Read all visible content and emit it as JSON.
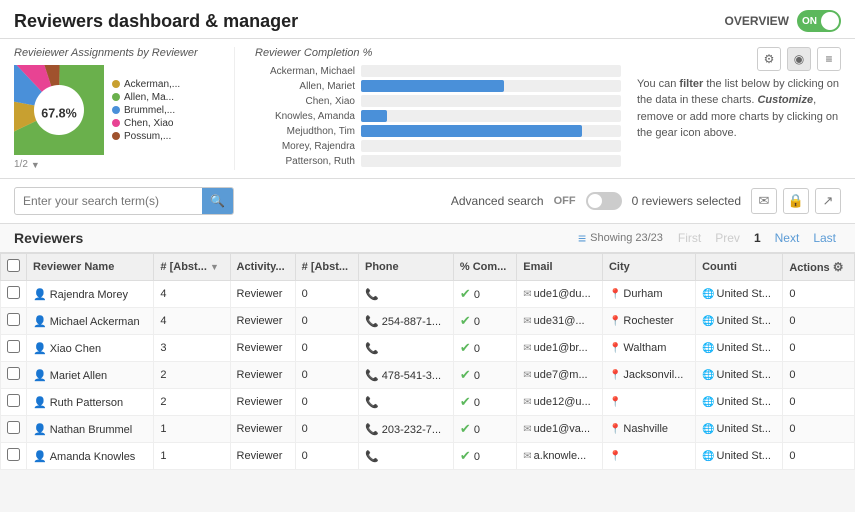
{
  "header": {
    "title": "Reviewers dashboard & manager",
    "overview_label": "OVERVIEW",
    "toggle_state": "ON"
  },
  "chart_section": {
    "pie_title": "Revieiewer Assignments by Reviewer",
    "bar_title": "Reviewer Completion %",
    "pie_percentage": "67.8%",
    "pie_nav": "1/2",
    "pie_legend": [
      {
        "label": "Ackerman,...",
        "color": "#c8a030"
      },
      {
        "label": "Allen, Ma...",
        "color": "#6ab04c"
      },
      {
        "label": "Brummel,...",
        "color": "#4a90d9"
      },
      {
        "label": "Chen, Xiao",
        "color": "#e84393"
      },
      {
        "label": "Possum,...",
        "color": "#a0522d"
      }
    ],
    "bar_rows": [
      {
        "label": "Ackerman, Michael",
        "pct": 0
      },
      {
        "label": "Allen, Mariet",
        "pct": 55
      },
      {
        "label": "Chen, Xiao",
        "pct": 0
      },
      {
        "label": "Knowles, Amanda",
        "pct": 10
      },
      {
        "label": "Mejudthon, Tim",
        "pct": 85
      },
      {
        "label": "Morey, Rajendra",
        "pct": 0
      },
      {
        "label": "Patterson, Ruth",
        "pct": 0
      }
    ],
    "info_text_part1": "You can ",
    "info_filter": "filter",
    "info_text_part2": " the list below by clicking on the data in these charts. ",
    "info_customize": "Customize",
    "info_text_part3": ", remove or add more charts by clicking on the gear icon above."
  },
  "search_bar": {
    "placeholder": "Enter your search term(s)",
    "advanced_label": "Advanced search",
    "off_label": "OFF",
    "selected_count": "0 reviewers selected"
  },
  "table": {
    "title": "Reviewers",
    "showing": "Showing 23/23",
    "pagination": {
      "first": "First",
      "prev": "Prev",
      "current": "1",
      "next": "Next",
      "last": "Last"
    },
    "columns": [
      "",
      "Reviewer Name",
      "# [Abst...",
      "Activity...",
      "# [Abst...",
      "Phone",
      "% Com...",
      "Email",
      "City",
      "Counti",
      "Actions"
    ],
    "rows": [
      {
        "name": "Rajendra Morey",
        "abs1": "4",
        "activity": "Reviewer",
        "abs2": "0",
        "phone": "",
        "pct": "0",
        "email": "ude1@du...",
        "city": "Durham",
        "country": "United St...",
        "actions": "0"
      },
      {
        "name": "Michael Ackerman",
        "abs1": "4",
        "activity": "Reviewer",
        "abs2": "0",
        "phone": "254-887-1...",
        "pct": "0",
        "email": "ude31@...",
        "city": "Rochester",
        "country": "United St...",
        "actions": "0"
      },
      {
        "name": "Xiao Chen",
        "abs1": "3",
        "activity": "Reviewer",
        "abs2": "0",
        "phone": "",
        "pct": "0",
        "email": "ude1@br...",
        "city": "Waltham",
        "country": "United St...",
        "actions": "0"
      },
      {
        "name": "Mariet Allen",
        "abs1": "2",
        "activity": "Reviewer",
        "abs2": "0",
        "phone": "478-541-3...",
        "pct": "0",
        "email": "ude7@m...",
        "city": "Jacksonvil...",
        "country": "United St...",
        "actions": "0"
      },
      {
        "name": "Ruth Patterson",
        "abs1": "2",
        "activity": "Reviewer",
        "abs2": "0",
        "phone": "",
        "pct": "0",
        "email": "ude12@u...",
        "city": "",
        "country": "United St...",
        "actions": "0"
      },
      {
        "name": "Nathan Brummel",
        "abs1": "1",
        "activity": "Reviewer",
        "abs2": "0",
        "phone": "203-232-7...",
        "pct": "0",
        "email": "ude1@va...",
        "city": "Nashville",
        "country": "United St...",
        "actions": "0"
      },
      {
        "name": "Amanda Knowles",
        "abs1": "1",
        "activity": "Reviewer",
        "abs2": "0",
        "phone": "",
        "pct": "0",
        "email": "a.knowle...",
        "city": "",
        "country": "United St...",
        "actions": "0"
      }
    ]
  },
  "icons": {
    "search": "🔍",
    "gear": "⚙",
    "pie_chart": "◉",
    "list": "≡",
    "email": "✉",
    "lock": "🔒",
    "export": "↗",
    "filter": "≡",
    "phone": "📞",
    "location": "📍",
    "user": "👤",
    "sort_down": "▼",
    "check": "✔",
    "globe": "🌐"
  }
}
